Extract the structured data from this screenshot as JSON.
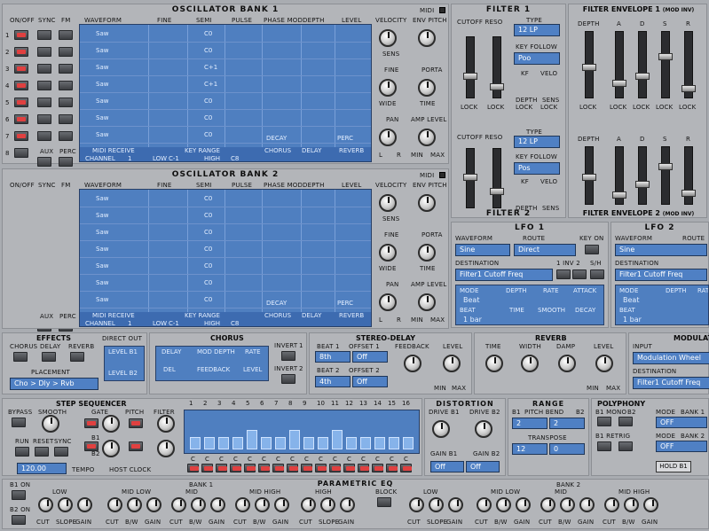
{
  "osc1": {
    "title": "OSCILLATOR BANK 1",
    "midi": "MIDI",
    "cols": [
      "ON/OFF",
      "SYNC",
      "FM",
      "WAVEFORM",
      "FINE",
      "SEMI",
      "PULSE",
      "PHASE MOD",
      "DEPTH",
      "LEVEL"
    ],
    "rows": [
      {
        "wave": "Saw",
        "semi": "C0"
      },
      {
        "wave": "Saw",
        "semi": "C0"
      },
      {
        "wave": "Saw",
        "semi": "C+1"
      },
      {
        "wave": "Saw",
        "semi": "C+1"
      },
      {
        "wave": "Saw",
        "semi": "C0"
      },
      {
        "wave": "Saw",
        "semi": "C0"
      },
      {
        "wave": "Saw",
        "semi": "C0"
      }
    ],
    "bottom": {
      "midi_receive": "MIDI RECEIVE",
      "key_range": "KEY RANGE",
      "chorus": "CHORUS",
      "delay": "DELAY",
      "reverb": "REVERB",
      "channel": "CHANNEL",
      "ch_val": "1",
      "low": "LOW",
      "low_val": "C-1",
      "high": "HIGH",
      "high_val": "C8",
      "decay": "DECAY",
      "perc": "PERC",
      "aux": "AUX",
      "perc2": "PERC"
    },
    "knobs": {
      "velocity": "VELOCITY",
      "env_pitch": "ENV PITCH",
      "sens": "SENS",
      "fine": "FINE",
      "porta": "PORTA",
      "wide": "WIDE",
      "time": "TIME",
      "pan": "PAN",
      "amp_level": "AMP LEVEL",
      "l": "L",
      "r": "R",
      "min": "MIN",
      "max": "MAX"
    }
  },
  "osc2": {
    "title": "OSCILLATOR BANK 2",
    "midi": "MIDI",
    "cols": [
      "ON/OFF",
      "SYNC",
      "FM",
      "WAVEFORM",
      "FINE",
      "SEMI",
      "PULSE",
      "PHASE MOD",
      "DEPTH",
      "LEVEL"
    ],
    "rows": [
      {
        "wave": "Saw",
        "semi": "C0"
      },
      {
        "wave": "Saw",
        "semi": "C0"
      },
      {
        "wave": "Saw",
        "semi": "C0"
      },
      {
        "wave": "Saw",
        "semi": "C0"
      },
      {
        "wave": "Saw",
        "semi": "C0"
      },
      {
        "wave": "Saw",
        "semi": "C0"
      },
      {
        "wave": "Saw",
        "semi": "C0"
      }
    ],
    "bottom": {
      "midi_receive": "MIDI RECEIVE",
      "key_range": "KEY RANGE",
      "chorus": "CHORUS",
      "delay": "DELAY",
      "reverb": "REVERB",
      "channel": "CHANNEL",
      "ch_val": "1",
      "low": "LOW",
      "low_val": "C-1",
      "high": "HIGH",
      "high_val": "C8",
      "decay": "DECAY",
      "perc": "PERC",
      "aux": "AUX",
      "perc2": "PERC"
    }
  },
  "row_numbers": [
    "1",
    "2",
    "3",
    "4",
    "5",
    "6",
    "7",
    "8"
  ],
  "filter": {
    "title1": "FILTER 1",
    "title2": "FILTER 2",
    "cutoff_reso": "CUTOFF RESO",
    "type": "TYPE",
    "type1": "12 LP",
    "type2": "12 LP",
    "keyfollow": "KEY FOLLOW",
    "kf1": "Poo",
    "kf2": "Pos",
    "kf": "KF",
    "velo": "VELO",
    "depth": "DEPTH",
    "sens": "SENS",
    "lock": "LOCK"
  },
  "fenv": {
    "title1": "FILTER ENVELOPE 1",
    "title2": "FILTER ENVELOPE 2",
    "mod": "(MOD INV)",
    "depth": "DEPTH",
    "lock": "LOCK",
    "stages": [
      "A",
      "D",
      "S",
      "R"
    ]
  },
  "lfo1": {
    "title": "LFO 1",
    "waveform": "WAVEFORM",
    "route": "ROUTE",
    "keyon": "KEY ON",
    "wave": "Sine",
    "route_val": "Direct",
    "destination": "DESTINATION",
    "dest_val": "Filter1 Cutoff Freq",
    "inv": "1 INV 2",
    "sh": "S/H",
    "mode": "MODE",
    "mode_val": "Beat",
    "depth": "DEPTH",
    "rate": "RATE",
    "attack": "ATTACK",
    "beat": "BEAT",
    "beat_val": "1 bar",
    "time": "TIME",
    "smooth": "SMOOTH",
    "decay": "DECAY"
  },
  "lfo2": {
    "title": "LFO 2",
    "waveform": "WAVEFORM",
    "route": "ROUTE",
    "wave": "Sine",
    "destination": "DESTINATION",
    "dest_val": "Filter1 Cutoff Freq",
    "mode": "MODE",
    "mode_val": "Beat",
    "depth": "DEPTH",
    "rate": "RATE",
    "beat": "BEAT",
    "beat_val": "1 bar"
  },
  "effects": {
    "title": "EFFECTS",
    "chorus": "CHORUS",
    "delay": "DELAY",
    "reverb": "REVERB",
    "direct_out": "DIRECT OUT",
    "level_b1": "LEVEL B1",
    "level_b2": "LEVEL B2",
    "placement": "PLACEMENT",
    "placement_val": "Cho > Dly > Rvb"
  },
  "chorus": {
    "title": "CHORUS",
    "delay": "DELAY",
    "mod_depth": "MOD DEPTH",
    "rate": "RATE",
    "del": "DEL",
    "feedback": "FEEDBACK",
    "level": "LEVEL",
    "invert": "INVERT",
    "n1": "1",
    "n2": "2"
  },
  "stereo_delay": {
    "title": "STEREO-DELAY",
    "beat1": "BEAT 1",
    "offset1": "OFFSET 1",
    "b1_val": "8th",
    "o1_val": "Off",
    "beat2": "BEAT 2",
    "offset2": "OFFSET 2",
    "b2_val": "4th",
    "o2_val": "Off",
    "feedback": "FEEDBACK",
    "level": "LEVEL",
    "min": "MIN",
    "max": "MAX"
  },
  "reverb": {
    "title": "REVERB",
    "time": "TIME",
    "width": "WIDTH",
    "damp": "DAMP",
    "level": "LEVEL",
    "min": "MIN",
    "max": "MAX"
  },
  "modulation": {
    "title": "MODULATION",
    "input": "INPUT",
    "input_val": "Modulation Wheel",
    "destination": "DESTINATION",
    "dest_val": "Filter1 Cutoff Freq"
  },
  "step": {
    "title": "STEP SEQUENCER",
    "bypass": "BYPASS",
    "smooth": "SMOOTH",
    "gate": "GATE",
    "pitch": "PITCH",
    "filter": "FILTER",
    "run": "RUN",
    "reset": "RESET",
    "sync": "SYNC",
    "b1": "B1",
    "b2": "B2",
    "tempo_val": "120.00",
    "tempo": "TEMPO",
    "host_clock": "HOST CLOCK",
    "steps": [
      "1",
      "2",
      "3",
      "4",
      "5",
      "6",
      "7",
      "8",
      "9",
      "10",
      "11",
      "12",
      "13",
      "14",
      "15",
      "16"
    ],
    "notes": [
      "C",
      "C",
      "C",
      "C",
      "C",
      "C",
      "C",
      "C",
      "C",
      "C",
      "C",
      "C",
      "C",
      "C",
      "C",
      "C"
    ],
    "levels": [
      0.35,
      0.35,
      0.35,
      0.35,
      0.55,
      0.35,
      0.35,
      0.55,
      0.35,
      0.35,
      0.55,
      0.35,
      0.35,
      0.35,
      0.35,
      0.35
    ]
  },
  "distortion": {
    "title": "DISTORTION",
    "drive_b1": "DRIVE B1",
    "drive_b2": "DRIVE B2",
    "gain_b1": "GAIN B1",
    "gain_b2": "GAIN B2",
    "off1": "Off",
    "off2": "Off"
  },
  "range": {
    "title": "RANGE",
    "pitch_bend": "PITCH BEND",
    "b1": "B1",
    "b2": "B2",
    "pb1": "2",
    "pb2": "2",
    "transpose": "TRANSPOSE",
    "t1": "12",
    "t2": "0"
  },
  "polyphony": {
    "title": "POLYPHONY",
    "b1_mono": "B1 MONO",
    "b2": "B2",
    "b1_retrig": "B1 RETRIG",
    "mode": "MODE",
    "bank1": "BANK 1",
    "bank2": "BANK 2",
    "off": "OFF",
    "hold": "HOLD B1"
  },
  "eq": {
    "title": "PARAMETRIC EQ",
    "b1_on": "B1 ON",
    "b2_on": "B2 ON",
    "bank1": "BANK 1",
    "bank2": "BANK 2",
    "block": "BLOCK",
    "low": "LOW",
    "mid_low": "MID LOW",
    "mid": "MID",
    "mid_high": "MID HIGH",
    "high": "HIGH",
    "cut": "CUT",
    "slope": "SLOPE",
    "gain": "GAIN",
    "bw": "B/W"
  }
}
